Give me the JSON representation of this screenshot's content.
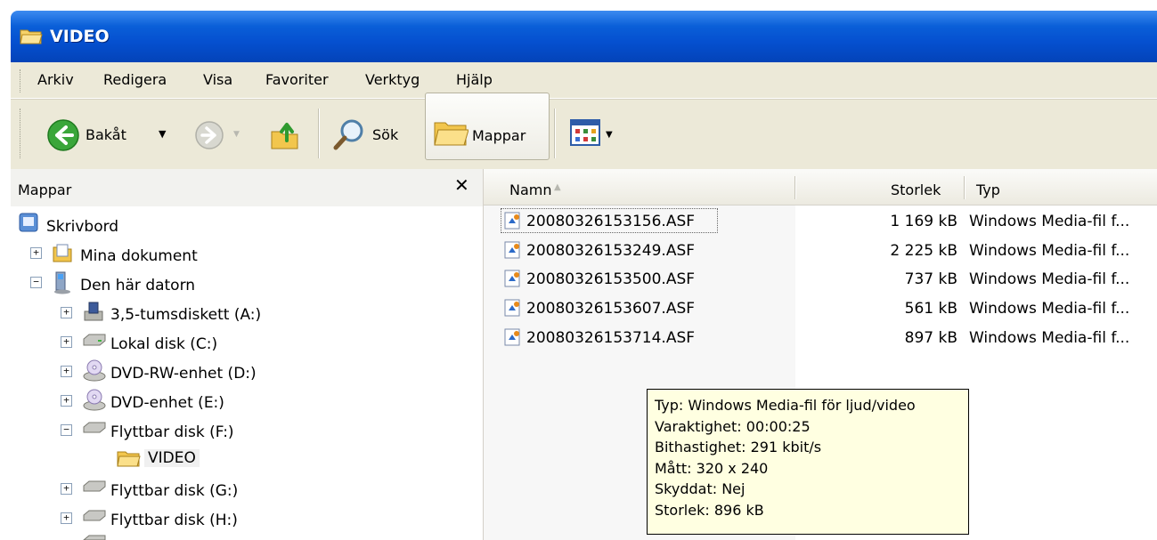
{
  "window": {
    "title": "VIDEO"
  },
  "menubar": {
    "items": [
      "Arkiv",
      "Redigera",
      "Visa",
      "Favoriter",
      "Verktyg",
      "Hjälp"
    ]
  },
  "toolbar": {
    "back_label": "Bakåt",
    "search_label": "Sök",
    "folders_label": "Mappar"
  },
  "left_pane": {
    "header": "Mappar",
    "tree": [
      {
        "label": "Skrivbord"
      },
      {
        "label": "Mina dokument"
      },
      {
        "label": "Den här datorn"
      },
      {
        "label": "3,5-tumsdiskett (A:)"
      },
      {
        "label": "Lokal disk (C:)"
      },
      {
        "label": "DVD-RW-enhet (D:)"
      },
      {
        "label": "DVD-enhet (E:)"
      },
      {
        "label": "Flyttbar disk (F:)"
      },
      {
        "label": "VIDEO"
      },
      {
        "label": "Flyttbar disk (G:)"
      },
      {
        "label": "Flyttbar disk (H:)"
      }
    ]
  },
  "file_list": {
    "columns": {
      "name": "Namn",
      "size": "Storlek",
      "type": "Typ"
    },
    "rows": [
      {
        "name": "20080326153156.ASF",
        "size": "1 169 kB",
        "type": "Windows Media-fil f..."
      },
      {
        "name": "20080326153249.ASF",
        "size": "2 225 kB",
        "type": "Windows Media-fil f..."
      },
      {
        "name": "20080326153500.ASF",
        "size": "737 kB",
        "type": "Windows Media-fil f..."
      },
      {
        "name": "20080326153607.ASF",
        "size": "561 kB",
        "type": "Windows Media-fil f..."
      },
      {
        "name": "20080326153714.ASF",
        "size": "897 kB",
        "type": "Windows Media-fil f..."
      }
    ]
  },
  "tooltip": {
    "lines": [
      "Typ: Windows Media-fil för ljud/video",
      "Varaktighet: 00:00:25",
      "Bithastighet: 291 kbit/s",
      "Mått: 320 x 240",
      "Skyddat: Nej",
      "Storlek: 896 kB"
    ]
  }
}
